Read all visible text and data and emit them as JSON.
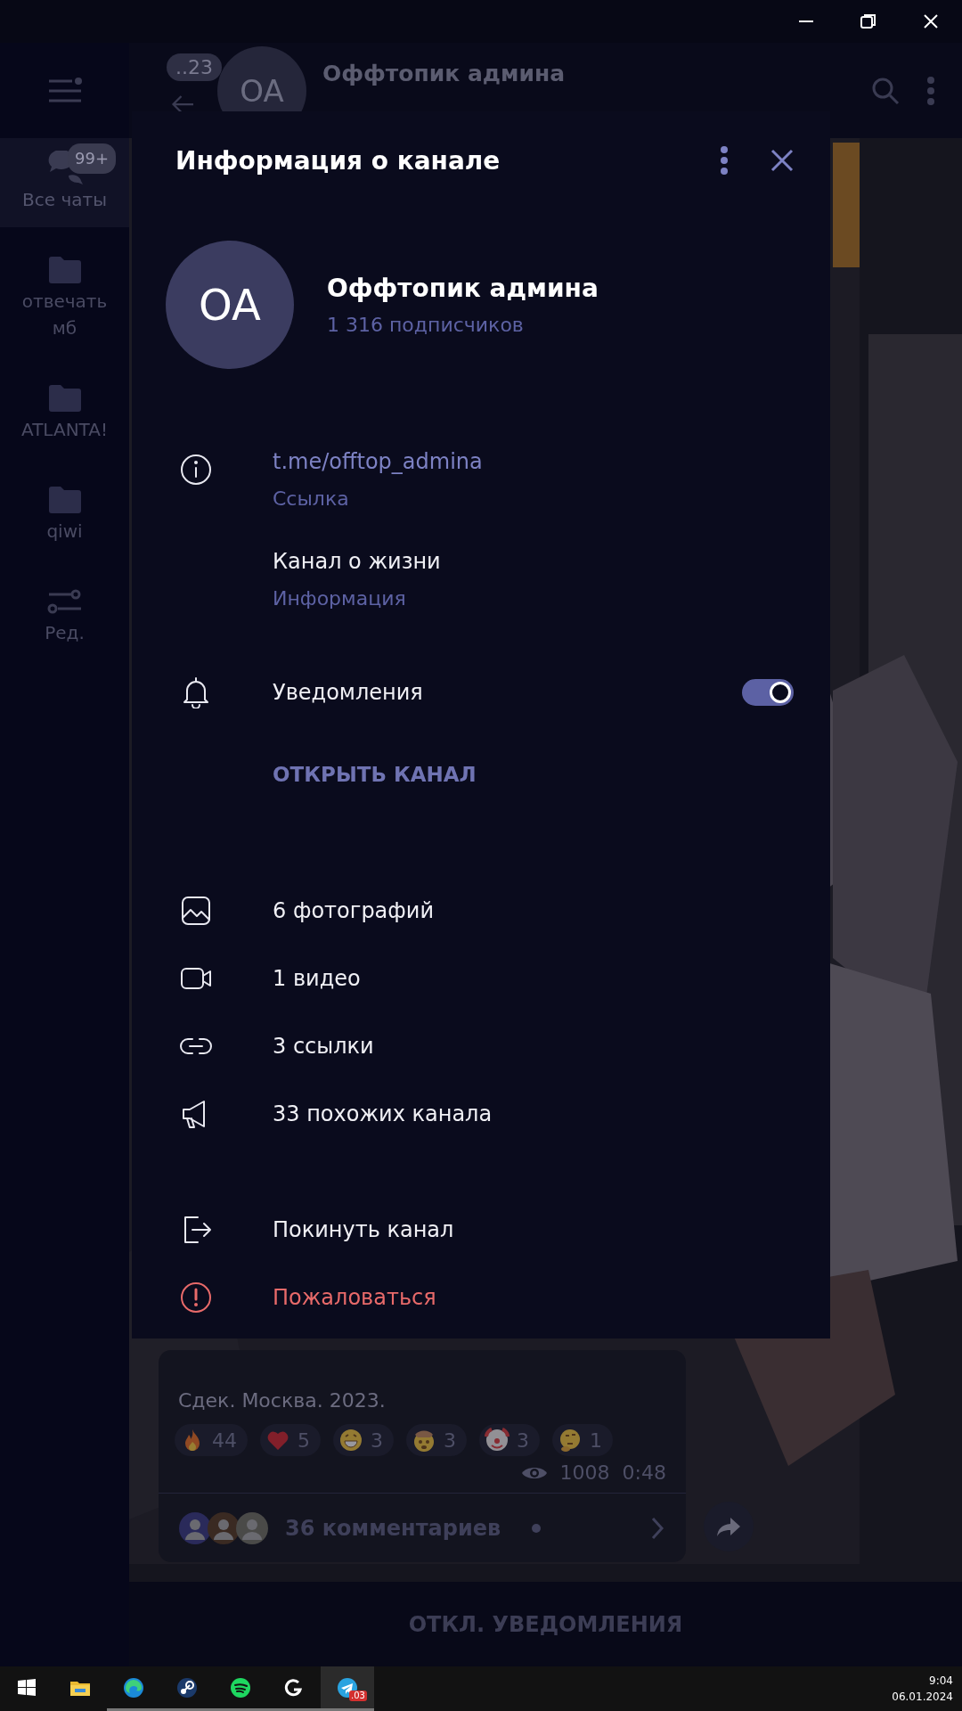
{
  "sidebar": {
    "items": [
      {
        "kind": "chats",
        "label": "Все чаты",
        "badge": "99+",
        "selected": true
      },
      {
        "kind": "folder",
        "label": "отвечать мб",
        "selected": false
      },
      {
        "kind": "folder",
        "label": "ATLANTA!",
        "selected": false
      },
      {
        "kind": "folder",
        "label": "qiwi",
        "selected": false
      },
      {
        "kind": "edit",
        "label": "Ред.",
        "selected": false
      }
    ]
  },
  "chat_header": {
    "back_badge": "..23",
    "initials": "OA",
    "title": "Оффтопик админа"
  },
  "message": {
    "caption": "Сдек. Москва. 2023.",
    "reactions": [
      {
        "kind": "fire",
        "count": "44"
      },
      {
        "kind": "heart",
        "count": "5"
      },
      {
        "kind": "grin",
        "count": "3"
      },
      {
        "kind": "exploding",
        "count": "3"
      },
      {
        "kind": "clown",
        "count": "3"
      },
      {
        "kind": "thinking",
        "count": "1"
      }
    ],
    "views": "1008",
    "duration": "0:48",
    "comments": "36 комментариев"
  },
  "bottom_bar": {
    "action": "ОТКЛ. УВЕДОМЛЕНИЯ"
  },
  "modal": {
    "title": "Информация о канале",
    "channel": {
      "initials": "OA",
      "name": "Оффтопик админа",
      "subscribers": "1 316 подписчиков"
    },
    "info": [
      {
        "kind": "link",
        "value": "t.me/offtop_admina",
        "label": "Ссылка"
      },
      {
        "kind": "about",
        "value": "Канал о жизни",
        "label": "Информация"
      }
    ],
    "notifications": {
      "label": "Уведомления",
      "on": true
    },
    "open_button": "ОТКРЫТЬ КАНАЛ",
    "media": [
      {
        "kind": "photos",
        "label": "6 фотографий"
      },
      {
        "kind": "videos",
        "label": "1 видео"
      },
      {
        "kind": "links",
        "label": "3 ссылки"
      },
      {
        "kind": "similar",
        "label": "33 похожих канала"
      }
    ],
    "actions": [
      {
        "kind": "leave",
        "label": "Покинуть канал"
      },
      {
        "kind": "report",
        "label": "Пожаловаться"
      }
    ]
  },
  "taskbar": {
    "apps": [
      {
        "kind": "start",
        "running": false,
        "selected": false
      },
      {
        "kind": "explorer",
        "running": false,
        "selected": false
      },
      {
        "kind": "edge",
        "running": true,
        "selected": false
      },
      {
        "kind": "steam",
        "running": true,
        "selected": false
      },
      {
        "kind": "spotify",
        "running": true,
        "selected": false
      },
      {
        "kind": "logitech",
        "running": true,
        "selected": false
      },
      {
        "kind": "telegram",
        "running": true,
        "selected": true,
        "badge": ".03"
      }
    ],
    "time": "9:04",
    "date": "06.01.2024"
  }
}
